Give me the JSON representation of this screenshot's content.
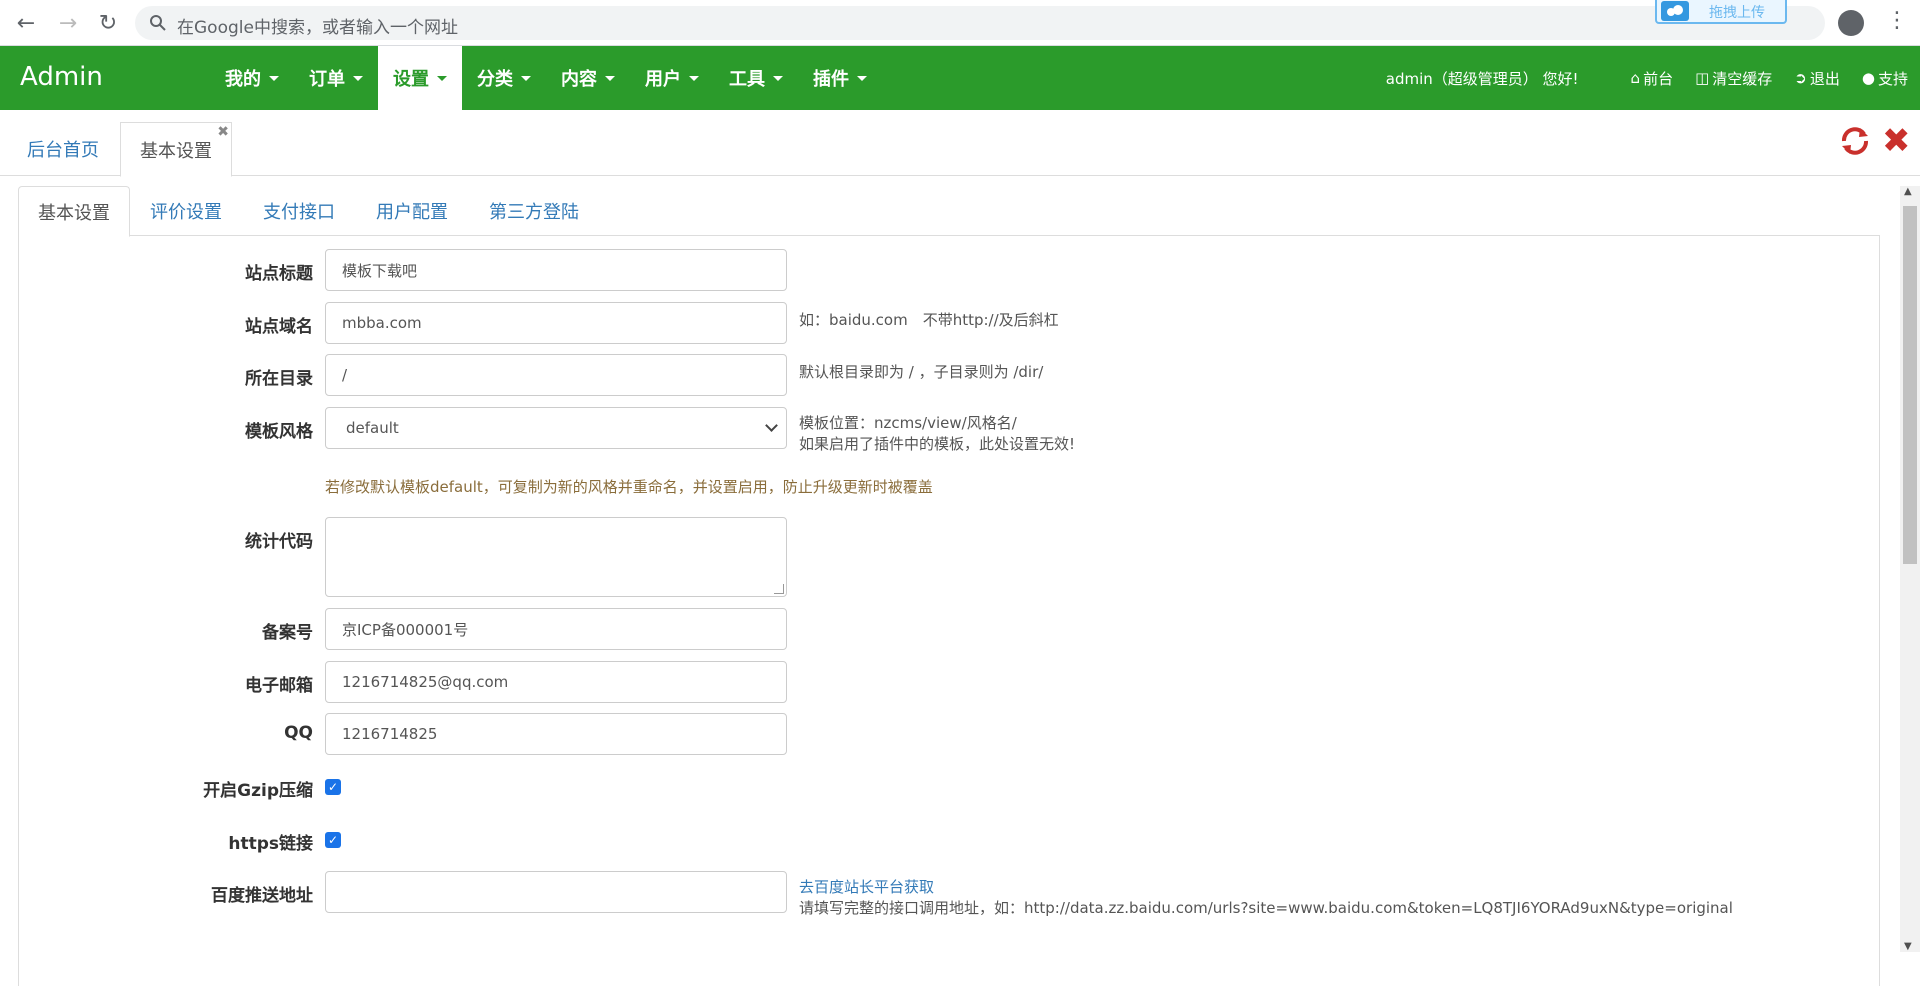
{
  "browser": {
    "omnibox_placeholder": "在Google中搜索，或者输入一个网址",
    "upload_label": "拖拽上传"
  },
  "header": {
    "brand": "Admin",
    "menu": [
      {
        "label": "我的"
      },
      {
        "label": "订单"
      },
      {
        "label": "设置",
        "active": true
      },
      {
        "label": "分类"
      },
      {
        "label": "内容"
      },
      {
        "label": "用户"
      },
      {
        "label": "工具"
      },
      {
        "label": "插件"
      }
    ],
    "greeting": "admin（超级管理员） 您好!",
    "links": {
      "frontend": "前台",
      "clear_cache": "清空缓存",
      "logout": "退出",
      "support": "支持"
    },
    "colors": {
      "bar": "#2b9b2b",
      "active_text": "#2b9b2b"
    }
  },
  "page_tabs": {
    "home": "后台首页",
    "basic": "基本设置"
  },
  "sub_tabs": [
    "基本设置",
    "评价设置",
    "支付接口",
    "用户配置",
    "第三方登陆"
  ],
  "form": {
    "site_title": {
      "label": "站点标题",
      "value": "模板下载吧"
    },
    "site_domain": {
      "label": "站点域名",
      "value": "mbba.com",
      "help": "如：baidu.com　不带http://及后斜杠"
    },
    "directory": {
      "label": "所在目录",
      "value": "/",
      "help": "默认根目录即为 / ，子目录则为 /dir/"
    },
    "template": {
      "label": "模板风格",
      "value": "default",
      "help1": "模板位置：nzcms/view/风格名/",
      "help2": "如果启用了插件中的模板，此处设置无效!"
    },
    "template_warning": "若修改默认模板default，可复制为新的风格并重命名，并设置启用，防止升级更新时被覆盖",
    "stats_code": {
      "label": "统计代码",
      "value": ""
    },
    "icp": {
      "label": "备案号",
      "value": "京ICP备000001号"
    },
    "email": {
      "label": "电子邮箱",
      "value": "1216714825@qq.com"
    },
    "qq": {
      "label": "QQ",
      "value": "1216714825"
    },
    "gzip": {
      "label": "开启Gzip压缩",
      "checked": true
    },
    "https": {
      "label": "https链接",
      "checked": true
    },
    "baidu_push": {
      "label": "百度推送地址",
      "value": "",
      "link": "去百度站长平台获取",
      "help": "请填写完整的接口调用地址，如：http://data.zz.baidu.com/urls?site=www.baidu.com&token=LQ8TJI6YORAd9uxN&type=original"
    }
  }
}
